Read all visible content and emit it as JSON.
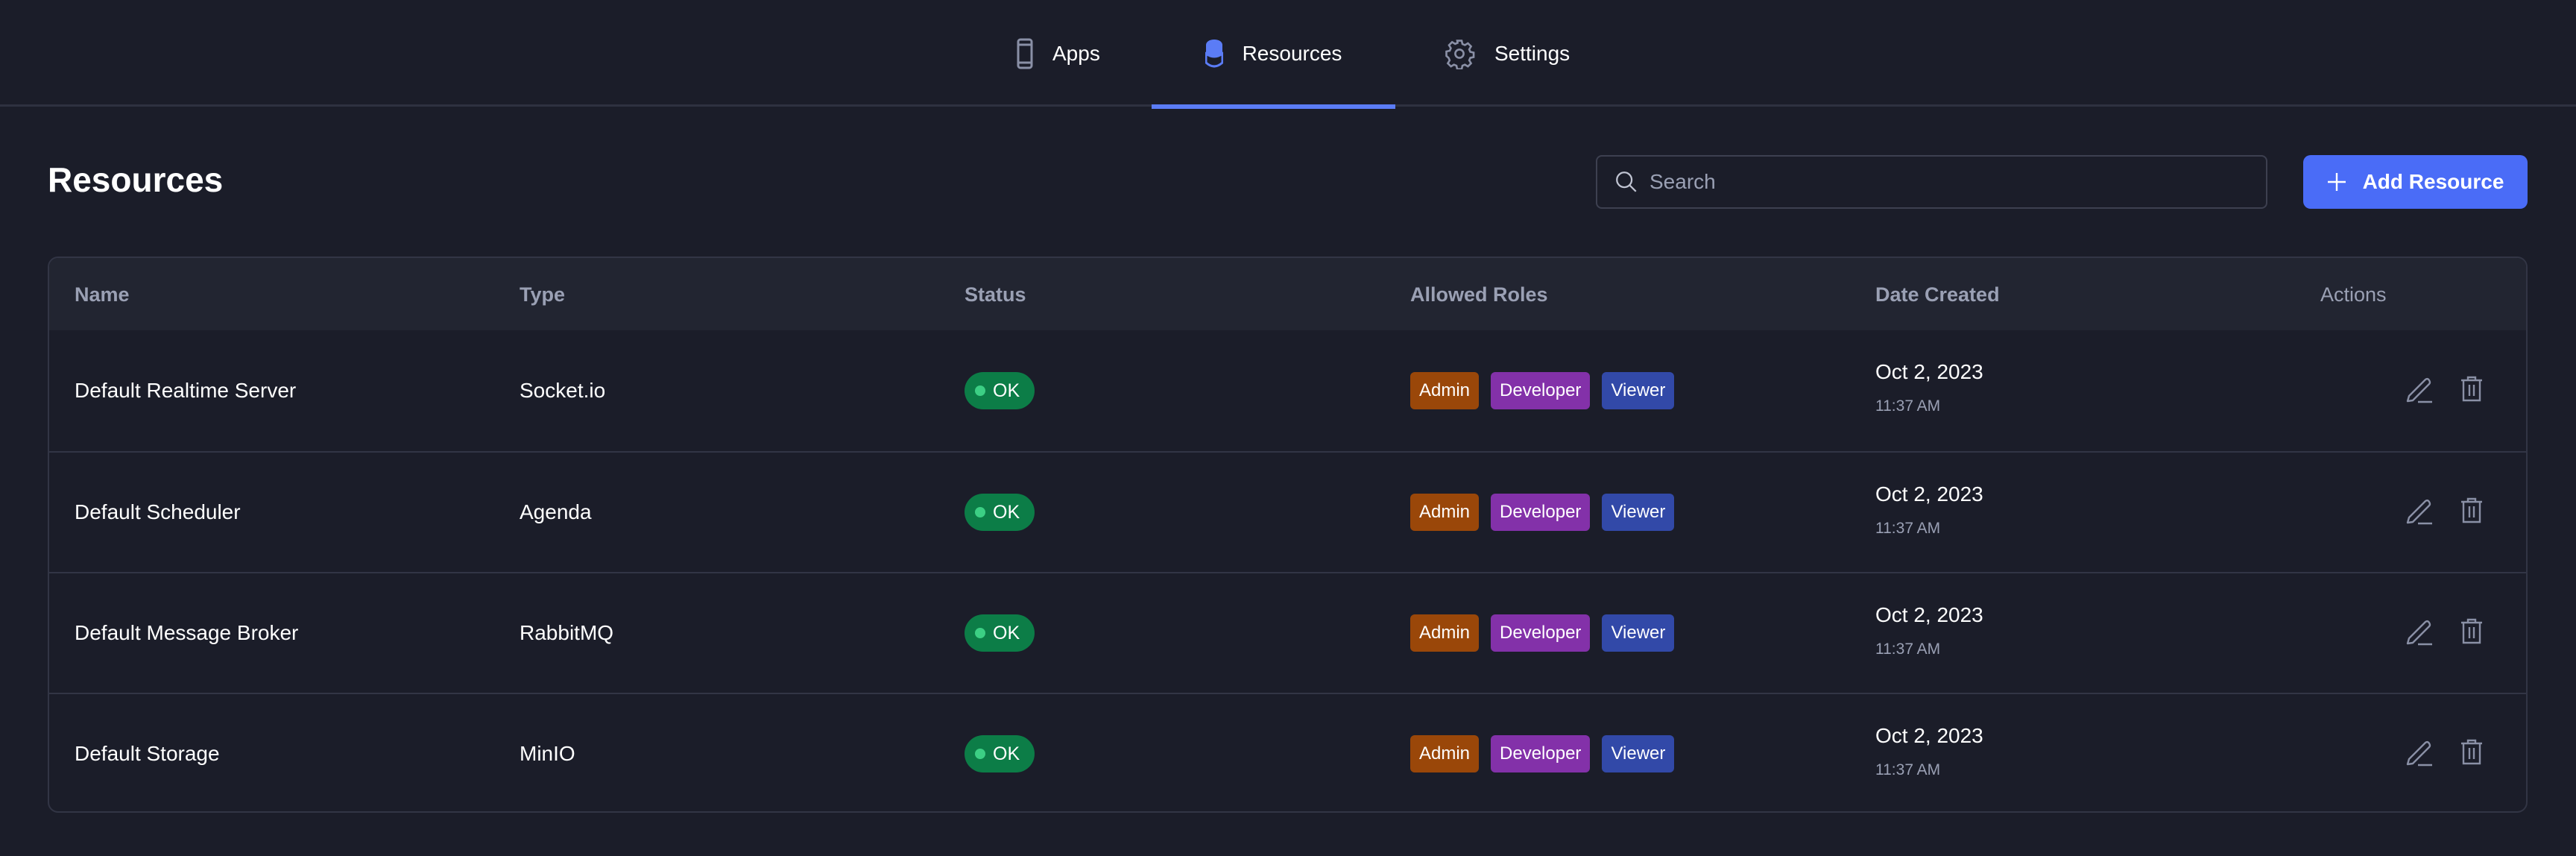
{
  "nav": {
    "tabs": [
      {
        "label": "Apps",
        "icon": "phone-icon"
      },
      {
        "label": "Resources",
        "icon": "database-icon",
        "active": true
      },
      {
        "label": "Settings",
        "icon": "gear-icon"
      }
    ]
  },
  "page": {
    "title": "Resources"
  },
  "search": {
    "placeholder": "Search",
    "value": ""
  },
  "add_button": {
    "label": "Add Resource"
  },
  "table": {
    "columns": [
      "Name",
      "Type",
      "Status",
      "Allowed Roles",
      "Date Created",
      "Actions"
    ],
    "rows": [
      {
        "name": "Default Realtime Server",
        "type": "Socket.io",
        "status": "OK",
        "roles": [
          "Admin",
          "Developer",
          "Viewer"
        ],
        "date": "Oct 2, 2023",
        "time": "11:37 AM"
      },
      {
        "name": "Default Scheduler",
        "type": "Agenda",
        "status": "OK",
        "roles": [
          "Admin",
          "Developer",
          "Viewer"
        ],
        "date": "Oct 2, 2023",
        "time": "11:37 AM"
      },
      {
        "name": "Default Message Broker",
        "type": "RabbitMQ",
        "status": "OK",
        "roles": [
          "Admin",
          "Developer",
          "Viewer"
        ],
        "date": "Oct 2, 2023",
        "time": "11:37 AM"
      },
      {
        "name": "Default Storage",
        "type": "MinIO",
        "status": "OK",
        "roles": [
          "Admin",
          "Developer",
          "Viewer"
        ],
        "date": "Oct 2, 2023",
        "time": "11:37 AM"
      }
    ]
  },
  "colors": {
    "accent": "#4a6cf7",
    "ok": "#0c7d47",
    "admin": "#9a4709",
    "developer": "#8331a9",
    "viewer": "#3249a8"
  }
}
